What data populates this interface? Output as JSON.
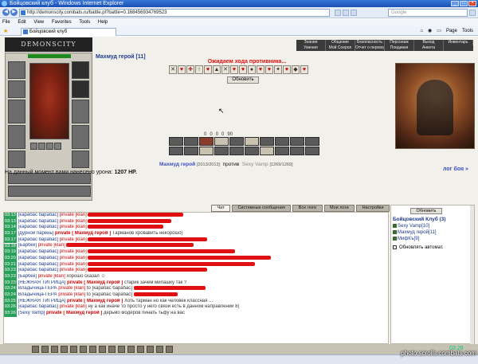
{
  "window": {
    "title": "Бойцовский клуб - Windows Internet Explorer"
  },
  "address": {
    "url": "http://demonscity.combats.ru/battle.pl?battle=0.168456934769523",
    "search_placeholder": "Google"
  },
  "menu": [
    "File",
    "Edit",
    "View",
    "Favorites",
    "Tools",
    "Help"
  ],
  "tab": {
    "title": "Бойцовский клуб"
  },
  "tools": {
    "page": "Page",
    "tools": "Tools"
  },
  "game": {
    "logo": "DEMONSCITY",
    "topnav": [
      "Знания",
      "Общение",
      "Безопасность",
      "Персонаж",
      "Выход",
      "Инвентарь",
      "Умения",
      "Мой Соерол",
      "Отчет о переводах",
      "Поединки",
      "Анкета"
    ],
    "player_name": "Махмуд герой [11]",
    "hp_bar": "2013/2013",
    "waiting": "Ожидаем хода противника...",
    "refresh": "Обновить",
    "stats": [
      "0",
      "0",
      "0",
      "0",
      "90"
    ],
    "damage_prefix": "На данный момент вами нанесено урона:",
    "damage_value": "1207 HP.",
    "opponent_line": {
      "p1": "Махмуд герой",
      "p1_hp": "[2013/2013]",
      "vs": "против",
      "p2": "Sexy Vamp",
      "p2_hp": "[1269/1269]"
    },
    "log_link": "лог боя »"
  },
  "chat": {
    "tabs": [
      "Чат",
      "Системные сообщения",
      "Все логи",
      "Мои логи",
      "Настройки"
    ],
    "lines": [
      {
        "time": "03:13",
        "nick": "[карабас барабас]",
        "tag": "private [klan]",
        "text": "",
        "redw": 120
      },
      {
        "time": "03:13",
        "nick": "[карабас барабас]",
        "tag": "private [klan]",
        "text": "",
        "redw": 105
      },
      {
        "time": "03:14",
        "nick": "[карабас барабас]",
        "tag": "private [klan]",
        "text": "",
        "redw": 95
      },
      {
        "time": "03:17",
        "nick": "[дурной парень]",
        "tag": "private [ Махмуд герой ]",
        "text": "Тарманов хровавить некорошо)",
        "redw": 0
      },
      {
        "time": "03:17",
        "nick": "[карабас барабас]",
        "tag": "private [klan]",
        "text": "",
        "redw": 150
      },
      {
        "time": "03:18",
        "nick": "[Барбек]",
        "tag": "private [klan]",
        "text": "",
        "redw": 160
      },
      {
        "time": "03:19",
        "nick": "[карабас барабас]",
        "tag": "private [klan]",
        "text": "",
        "redw": 185
      },
      {
        "time": "03:20",
        "nick": "[карабас барабас]",
        "tag": "private [klan]",
        "text": "",
        "redw": 230
      },
      {
        "time": "03:21",
        "nick": "[карабас барабас]",
        "tag": "private [klan]",
        "text": "",
        "redw": 210
      },
      {
        "time": "03:23",
        "nick": "[карабас барабас]",
        "tag": "private [klan]",
        "text": "",
        "redw": 150
      },
      {
        "time": "03:23",
        "nick": "[Барбек]",
        "tag": "private [klan]",
        "text": "хорошо сказал ☺",
        "redw": 0
      },
      {
        "time": "03:23",
        "nick": "[НЕЖНАЯ ТИГРИЦА]",
        "tag": "private [ Махмуд герой ]",
        "text": "старик зачем милашку так ?",
        "redw": 0
      },
      {
        "time": "03:24",
        "nick": "Владычица-ГЕРА",
        "tag": "private [klan]",
        "text": "to [карабас барабас]",
        "redw": 90
      },
      {
        "time": "03:24",
        "nick": "Владычица-ГЕРА",
        "tag": "private [klan]",
        "text": "to [карабас барабас]",
        "redw": 55
      },
      {
        "time": "03:25",
        "nick": "[НЕЖНАЯ ТИГРИЦА]",
        "tag": "private [ Махмуд герой ]",
        "text": "Хоть тарман но как человек классная ...",
        "redw": 0
      },
      {
        "time": "03:26",
        "nick": "[карабас барабас]",
        "tag": "private [klan]",
        "text": "ну а как иначе то просто у него связи есть в данном направлении 8)",
        "redw": 0
      },
      {
        "time": "03:26",
        "nick": "[Sexy Vamp]",
        "tag": "private [ Махмуд герой ]",
        "text": "дерьмо модеров пинать тьфу на вас",
        "redw": 0
      }
    ]
  },
  "sidebar": {
    "refresh": "Обновить",
    "club": "Бойцовский Клуб (3)",
    "users": [
      "Sexy Vamp[10]",
      "Махмуд герой[11]",
      "МифКъ[9]"
    ],
    "auto": "Обновлять автомат."
  },
  "clock": "03:26",
  "status": "",
  "watermark": "photo.scrolls.combats.com"
}
